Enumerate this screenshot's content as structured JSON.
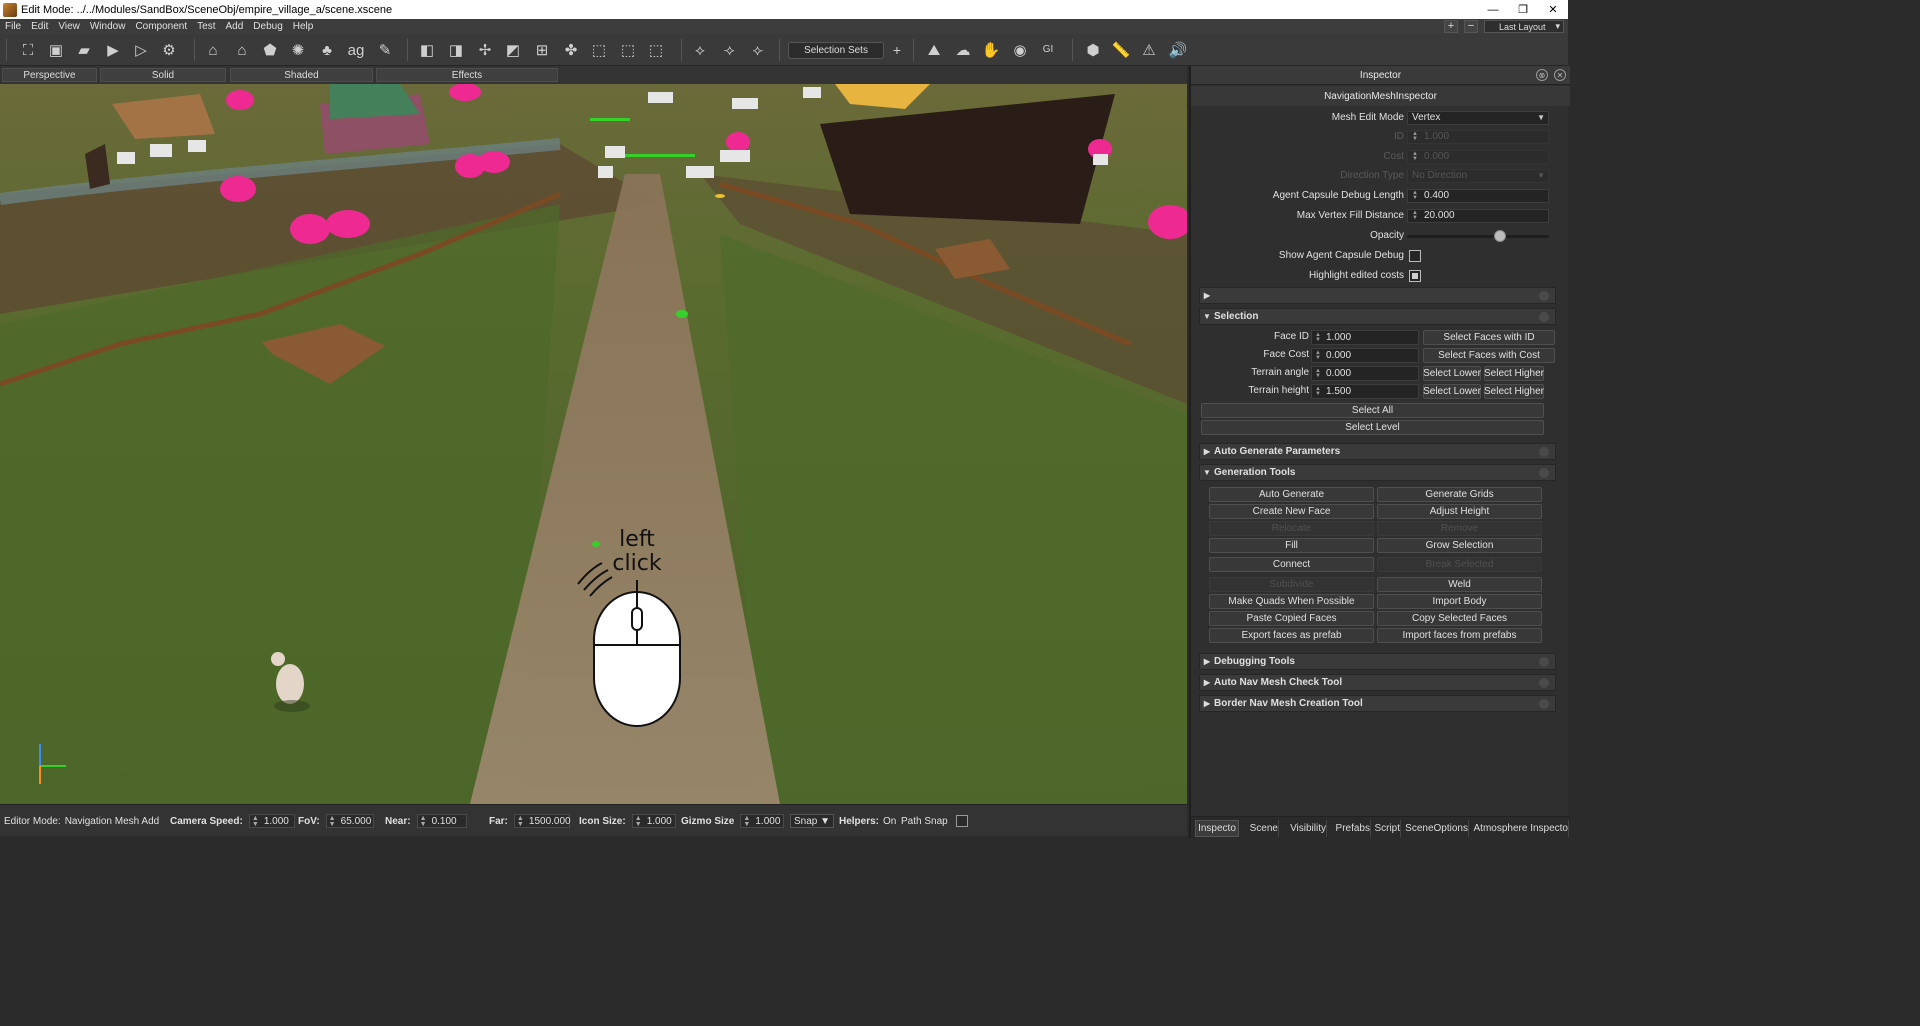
{
  "title_bar": {
    "title": "Edit Mode: ../../Modules/SandBox/SceneObj/empire_village_a/scene.xscene",
    "minimize": "—",
    "restore": "❐",
    "close": "✕"
  },
  "menu": {
    "items": [
      "File",
      "Edit",
      "View",
      "Window",
      "Component",
      "Test",
      "Add",
      "Debug",
      "Help"
    ],
    "layout_label": "Last Layout",
    "add": "+",
    "remove": "−"
  },
  "toolbar": {
    "selection_sets": "Selection Sets",
    "add": "+"
  },
  "viewport": {
    "tabs": [
      "Perspective",
      "Solid",
      "Shaded",
      "Effects"
    ],
    "overlay_text_line1": "left",
    "overlay_text_line2": "click"
  },
  "status_bar": {
    "editor_mode_label": "Editor Mode:",
    "editor_mode_value": "Navigation Mesh Add",
    "camera_speed_label": "Camera Speed:",
    "camera_speed_value": "1.000",
    "fov_label": "FoV:",
    "fov_value": "65.000",
    "near_label": "Near:",
    "near_value": "0.100",
    "far_label": "Far:",
    "far_value": "1500.000",
    "icon_size_label": "Icon Size:",
    "icon_size_value": "1.000",
    "gizmo_size_label": "Gizmo Size",
    "gizmo_size_value": "1.000",
    "snap": "Snap",
    "helpers_label": "Helpers:",
    "helpers_value": "On",
    "path_snap_label": "Path Snap"
  },
  "inspector": {
    "title": "Inspector",
    "subtitle": "NavigationMeshInspector",
    "props": {
      "mesh_edit_mode_label": "Mesh Edit Mode",
      "mesh_edit_mode_value": "Vertex",
      "id_label": "ID",
      "id_value": "1.000",
      "cost_label": "Cost",
      "cost_value": "0.000",
      "direction_type_label": "Direction Type",
      "direction_type_value": "No Direction",
      "agent_capsule_label": "Agent Capsule Debug Length",
      "agent_capsule_value": "0.400",
      "max_vertex_label": "Max Vertex Fill Distance",
      "max_vertex_value": "20.000",
      "opacity_label": "Opacity",
      "opacity_level": 0.67,
      "show_agent_label": "Show Agent Capsule Debug",
      "highlight_label": "Highlight edited costs"
    },
    "selection": {
      "header": "Selection",
      "face_id_label": "Face ID",
      "face_id_value": "1.000",
      "face_cost_label": "Face Cost",
      "face_cost_value": "0.000",
      "terrain_angle_label": "Terrain angle",
      "terrain_angle_value": "0.000",
      "terrain_height_label": "Terrain height",
      "terrain_height_value": "1.500",
      "select_faces_id": "Select Faces with ID",
      "select_faces_cost": "Select Faces with Cost",
      "select_lower": "Select Lower",
      "select_higher": "Select Higher",
      "select_all": "Select All",
      "select_level": "Select Level"
    },
    "auto_generate_header": "Auto Generate Parameters",
    "generation": {
      "header": "Generation Tools",
      "auto_generate": "Auto Generate",
      "generate_grids": "Generate Grids",
      "create_new_face": "Create New Face",
      "adjust_height": "Adjust Height",
      "relocate": "Relocate",
      "remove": "Remove",
      "fill": "Fill",
      "grow_selection": "Grow Selection",
      "connect": "Connect",
      "break_selected": "Break Selected",
      "subdivide": "Subdivide",
      "weld": "Weld",
      "make_quads": "Make Quads When Possible",
      "import_body": "Import Body",
      "paste_faces": "Paste Copied Faces",
      "copy_faces": "Copy Selected Faces",
      "export_prefab": "Export faces as prefab",
      "import_prefab": "Import faces from prefabs"
    },
    "debugging_header": "Debugging Tools",
    "auto_nav_header": "Auto Nav Mesh Check Tool",
    "border_nav_header": "Border Nav Mesh Creation Tool",
    "tabs": [
      "Inspecto",
      "Scene",
      "Visibility",
      "Prefabs",
      "Script",
      "SceneOptions",
      "Atmosphere Inspecto"
    ]
  }
}
